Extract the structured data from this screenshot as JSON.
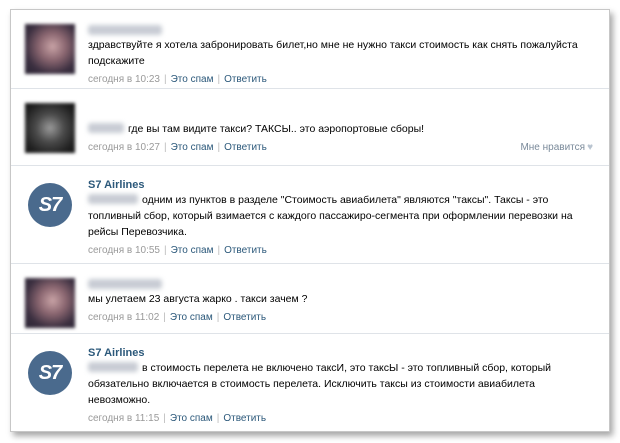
{
  "comments": [
    {
      "author": "",
      "text": "здравствуйте я хотела забронировать билет,но мне не нужно такси стоимость как снять пожалуйста подскажите",
      "time": "сегодня в 10:23",
      "spam": "Это спам",
      "reply": "Ответить"
    },
    {
      "author": "",
      "text": "где вы там видите такси? ТАКСЫ.. это аэропортовые сборы!",
      "time": "сегодня в 10:27",
      "spam": "Это спам",
      "reply": "Ответить",
      "like": "Мне нравится"
    },
    {
      "author": "S7 Airlines",
      "text": "одним из пунктов в разделе \"Стоимость авиабилета\" являются \"таксы\". Таксы - это топливный сбор, который взимается с каждого пассажиро-сегмента при оформлении перевозки на рейсы Перевозчика.",
      "time": "сегодня в 10:55",
      "spam": "Это спам",
      "reply": "Ответить",
      "logo_text": "S7"
    },
    {
      "author": "",
      "text": "мы улетаем 23 августа жарко . такси зачем ?",
      "time": "сегодня в 11:02",
      "spam": "Это спам",
      "reply": "Ответить"
    },
    {
      "author": "S7 Airlines",
      "text": "в стоимость перелета не включено таксИ, это таксЫ - это топливный сбор, который обязательно включается в стоимость перелета. Исключить таксы из стоимости авиабилета невозможно.",
      "time": "сегодня в 11:15",
      "spam": "Это спам",
      "reply": "Ответить",
      "logo_text": "S7"
    }
  ],
  "separator": "|",
  "like_icon": "heart-icon",
  "colors": {
    "link": "#2b587a",
    "meta": "#999999",
    "logo_bg": "#4a6a8d"
  }
}
